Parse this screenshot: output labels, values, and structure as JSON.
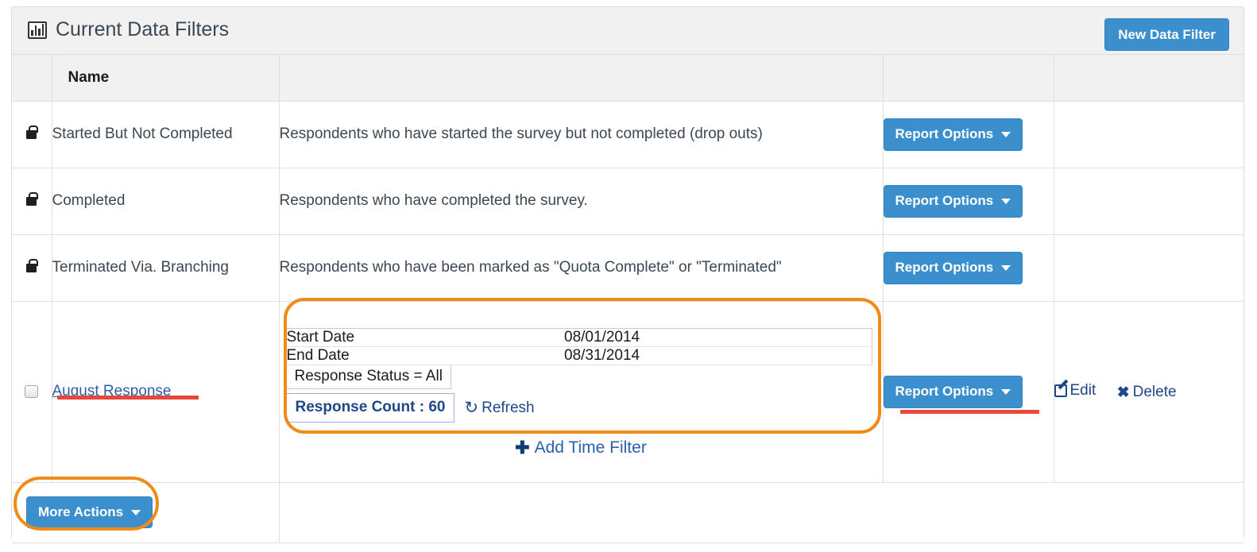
{
  "header": {
    "title": "Current Data Filters",
    "icon": "bar-chart-icon",
    "new_filter_label": "New Data Filter",
    "accent_color": "#3b8fcd"
  },
  "table": {
    "columns": [
      "",
      "Name",
      "",
      "",
      ""
    ],
    "name_header": "Name",
    "rows": [
      {
        "locked": true,
        "lock_icon": "lock-icon",
        "name": "Started But Not Completed",
        "description": "Respondents who have started the survey but not completed (drop outs)",
        "report_label": "Report Options"
      },
      {
        "locked": true,
        "lock_icon": "lock-icon",
        "name": "Completed",
        "description": "Respondents who have completed the survey.",
        "report_label": "Report Options"
      },
      {
        "locked": true,
        "lock_icon": "lock-icon",
        "name": "Terminated Via. Branching",
        "description": "Respondents who have been marked as \"Quota Complete\" or \"Terminated\"",
        "report_label": "Report Options"
      }
    ],
    "custom_row": {
      "checkbox_checked": false,
      "name": "August Response",
      "report_label": "Report Options",
      "edit_label": "Edit",
      "edit_icon": "pencil-square-icon",
      "delete_label": "Delete",
      "delete_icon": "close-x-icon",
      "detail": {
        "start_date_label": "Start Date",
        "start_date_value": "08/01/2014",
        "end_date_label": "End Date",
        "end_date_value": "08/31/2014",
        "response_status": "Response Status = All",
        "response_count": "Response Count : 60",
        "refresh_label": "Refresh",
        "refresh_icon": "refresh-icon"
      },
      "add_time_filter_label": "Add Time Filter",
      "add_time_filter_icon": "plus-icon"
    }
  },
  "footer": {
    "more_actions_label": "More Actions"
  },
  "annotations": {
    "highlight_color": "#f08a18",
    "underline_color": "#e8483c"
  }
}
